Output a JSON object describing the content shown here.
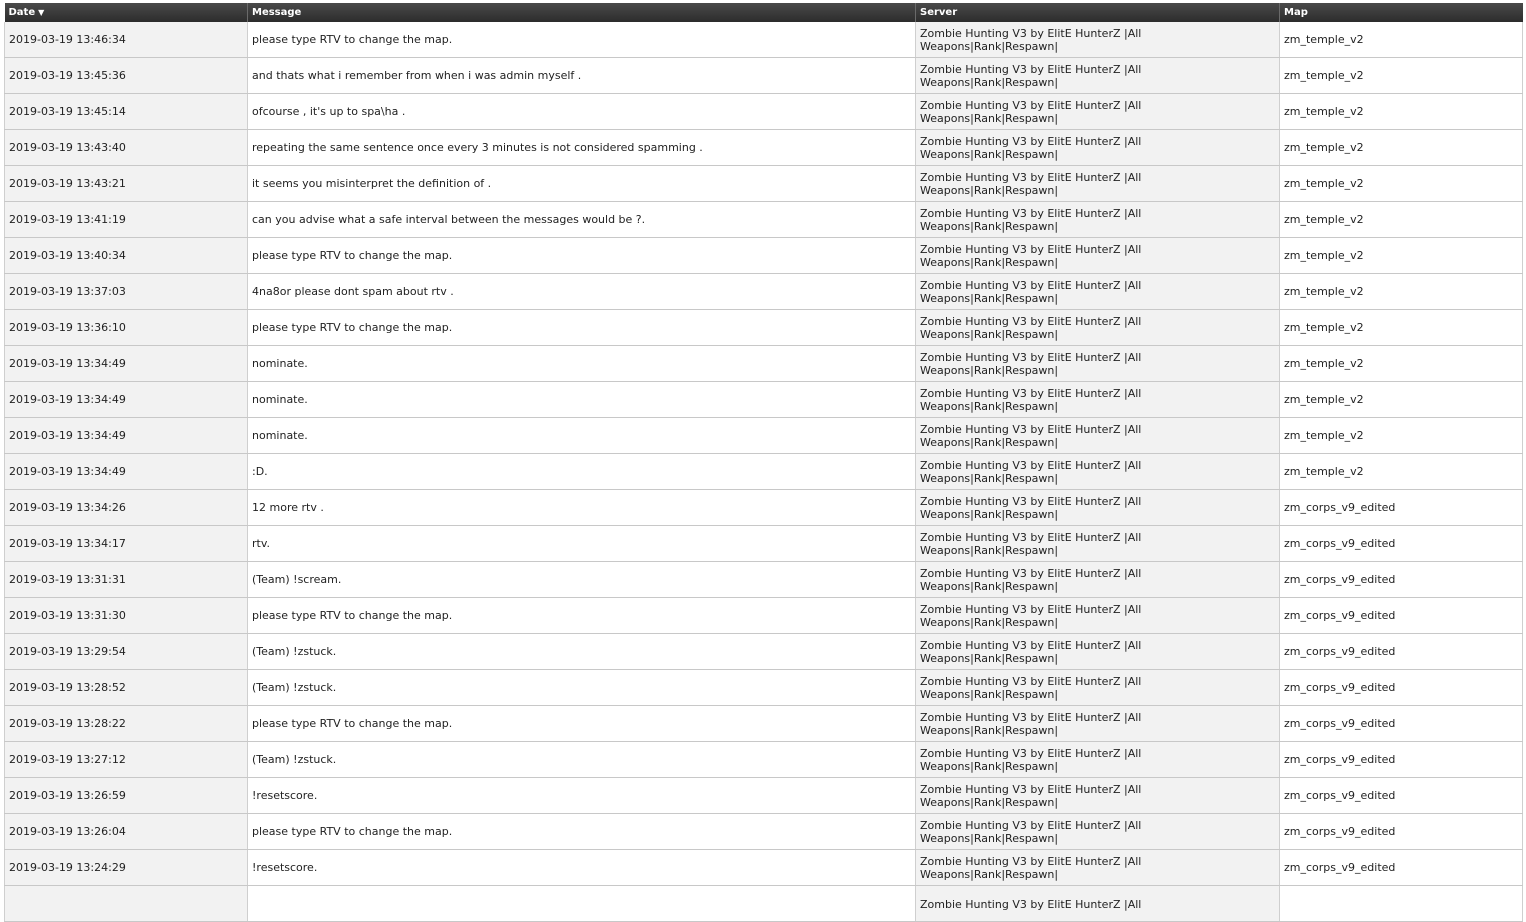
{
  "table": {
    "columns": [
      {
        "label": "Date",
        "sort": "desc"
      },
      {
        "label": "Message"
      },
      {
        "label": "Server"
      },
      {
        "label": "Map"
      }
    ],
    "rows": [
      {
        "date": "2019-03-19 13:46:34",
        "message": "please type RTV to change the map.",
        "server": "Zombie Hunting V3 by ElitE HunterZ |All Weapons|Rank|Respawn|",
        "map": "zm_temple_v2"
      },
      {
        "date": "2019-03-19 13:45:36",
        "message": "and thats what i remember from when i was admin myself .",
        "server": "Zombie Hunting V3 by ElitE HunterZ |All Weapons|Rank|Respawn|",
        "map": "zm_temple_v2"
      },
      {
        "date": "2019-03-19 13:45:14",
        "message": "ofcourse , it's up to spa\\ha .",
        "server": "Zombie Hunting V3 by ElitE HunterZ |All Weapons|Rank|Respawn|",
        "map": "zm_temple_v2"
      },
      {
        "date": "2019-03-19 13:43:40",
        "message": "repeating the same sentence once every 3 minutes is not considered spamming .",
        "server": "Zombie Hunting V3 by ElitE HunterZ |All Weapons|Rank|Respawn|",
        "map": "zm_temple_v2"
      },
      {
        "date": "2019-03-19 13:43:21",
        "message": "it seems you misinterpret the definition of .",
        "server": "Zombie Hunting V3 by ElitE HunterZ |All Weapons|Rank|Respawn|",
        "map": "zm_temple_v2"
      },
      {
        "date": "2019-03-19 13:41:19",
        "message": "can you advise what a safe interval between the messages would be ?.",
        "server": "Zombie Hunting V3 by ElitE HunterZ |All Weapons|Rank|Respawn|",
        "map": "zm_temple_v2"
      },
      {
        "date": "2019-03-19 13:40:34",
        "message": "please type RTV to change the map.",
        "server": "Zombie Hunting V3 by ElitE HunterZ |All Weapons|Rank|Respawn|",
        "map": "zm_temple_v2"
      },
      {
        "date": "2019-03-19 13:37:03",
        "message": "4na8or please dont spam about rtv .",
        "server": "Zombie Hunting V3 by ElitE HunterZ |All Weapons|Rank|Respawn|",
        "map": "zm_temple_v2"
      },
      {
        "date": "2019-03-19 13:36:10",
        "message": "please type RTV to change the map.",
        "server": "Zombie Hunting V3 by ElitE HunterZ |All Weapons|Rank|Respawn|",
        "map": "zm_temple_v2"
      },
      {
        "date": "2019-03-19 13:34:49",
        "message": "nominate.",
        "server": "Zombie Hunting V3 by ElitE HunterZ |All Weapons|Rank|Respawn|",
        "map": "zm_temple_v2"
      },
      {
        "date": "2019-03-19 13:34:49",
        "message": "nominate.",
        "server": "Zombie Hunting V3 by ElitE HunterZ |All Weapons|Rank|Respawn|",
        "map": "zm_temple_v2"
      },
      {
        "date": "2019-03-19 13:34:49",
        "message": "nominate.",
        "server": "Zombie Hunting V3 by ElitE HunterZ |All Weapons|Rank|Respawn|",
        "map": "zm_temple_v2"
      },
      {
        "date": "2019-03-19 13:34:49",
        "message": ":D.",
        "server": "Zombie Hunting V3 by ElitE HunterZ |All Weapons|Rank|Respawn|",
        "map": "zm_temple_v2"
      },
      {
        "date": "2019-03-19 13:34:26",
        "message": "12 more rtv .",
        "server": "Zombie Hunting V3 by ElitE HunterZ |All Weapons|Rank|Respawn|",
        "map": "zm_corps_v9_edited"
      },
      {
        "date": "2019-03-19 13:34:17",
        "message": "rtv.",
        "server": "Zombie Hunting V3 by ElitE HunterZ |All Weapons|Rank|Respawn|",
        "map": "zm_corps_v9_edited"
      },
      {
        "date": "2019-03-19 13:31:31",
        "message": "(Team) !scream.",
        "server": "Zombie Hunting V3 by ElitE HunterZ |All Weapons|Rank|Respawn|",
        "map": "zm_corps_v9_edited"
      },
      {
        "date": "2019-03-19 13:31:30",
        "message": "please type RTV to change the map.",
        "server": "Zombie Hunting V3 by ElitE HunterZ |All Weapons|Rank|Respawn|",
        "map": "zm_corps_v9_edited"
      },
      {
        "date": "2019-03-19 13:29:54",
        "message": "(Team) !zstuck.",
        "server": "Zombie Hunting V3 by ElitE HunterZ |All Weapons|Rank|Respawn|",
        "map": "zm_corps_v9_edited"
      },
      {
        "date": "2019-03-19 13:28:52",
        "message": "(Team) !zstuck.",
        "server": "Zombie Hunting V3 by ElitE HunterZ |All Weapons|Rank|Respawn|",
        "map": "zm_corps_v9_edited"
      },
      {
        "date": "2019-03-19 13:28:22",
        "message": "please type RTV to change the map.",
        "server": "Zombie Hunting V3 by ElitE HunterZ |All Weapons|Rank|Respawn|",
        "map": "zm_corps_v9_edited"
      },
      {
        "date": "2019-03-19 13:27:12",
        "message": "(Team) !zstuck.",
        "server": "Zombie Hunting V3 by ElitE HunterZ |All Weapons|Rank|Respawn|",
        "map": "zm_corps_v9_edited"
      },
      {
        "date": "2019-03-19 13:26:59",
        "message": "!resetscore.",
        "server": "Zombie Hunting V3 by ElitE HunterZ |All Weapons|Rank|Respawn|",
        "map": "zm_corps_v9_edited"
      },
      {
        "date": "2019-03-19 13:26:04",
        "message": "please type RTV to change the map.",
        "server": "Zombie Hunting V3 by ElitE HunterZ |All Weapons|Rank|Respawn|",
        "map": "zm_corps_v9_edited"
      },
      {
        "date": "2019-03-19 13:24:29",
        "message": "!resetscore.",
        "server": "Zombie Hunting V3 by ElitE HunterZ |All Weapons|Rank|Respawn|",
        "map": "zm_corps_v9_edited"
      },
      {
        "date": "",
        "message": "",
        "server": "Zombie Hunting V3 by ElitE HunterZ |All",
        "map": ""
      }
    ]
  },
  "colors": {
    "header_background": "#3a3a3a",
    "header_text": "#ffffff",
    "shaded_cell": "#f2f2f2",
    "border": "#c8c8c8"
  }
}
